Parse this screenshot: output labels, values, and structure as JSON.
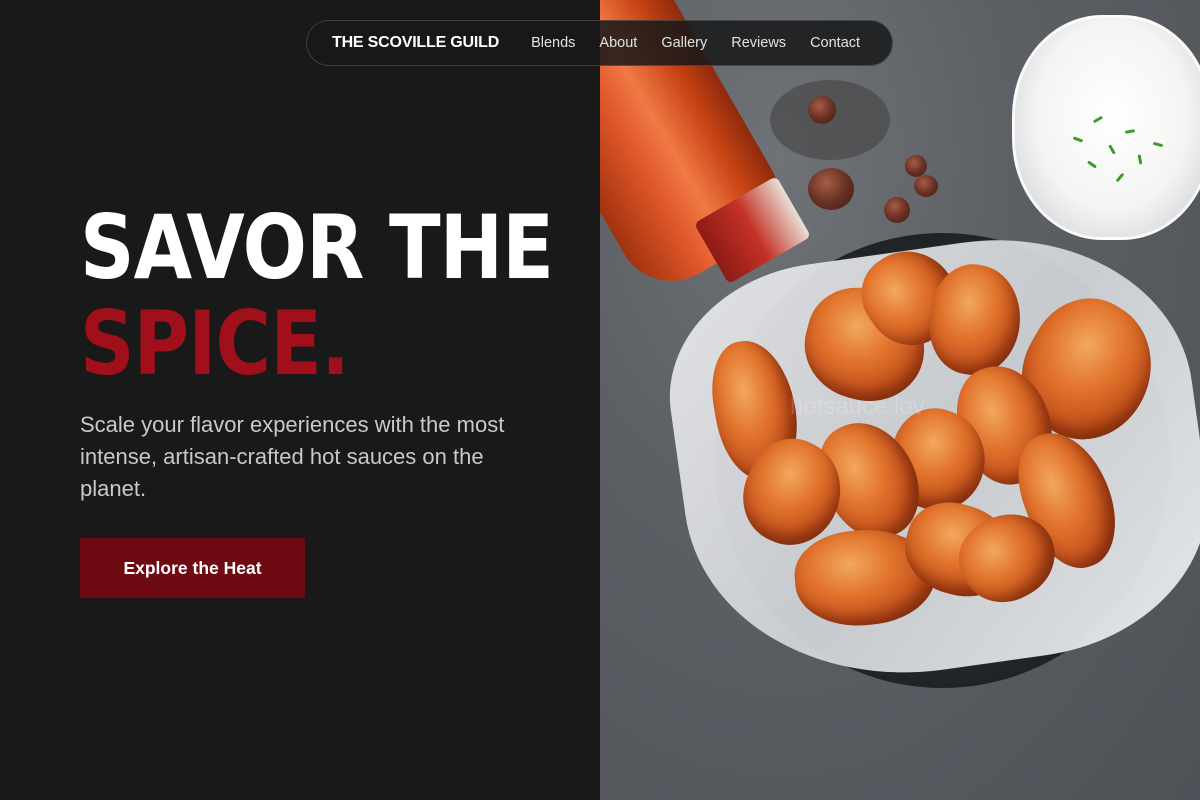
{
  "nav": {
    "brand": "THE SCOVILLE GUILD",
    "links": [
      "Blends",
      "About",
      "Gallery",
      "Reviews",
      "Contact"
    ]
  },
  "hero": {
    "headline_line1": "SAVOR THE",
    "headline_line2": "SPICE.",
    "subtitle": "Scale your flavor experiences with the most intense, artisan-crafted hot sauces on the planet.",
    "cta_label": "Explore the Heat"
  },
  "image": {
    "watermark": "hotsauce lov"
  },
  "colors": {
    "background": "#19191a",
    "accent_red": "#a1101a",
    "cta_background": "#6e0a12"
  }
}
